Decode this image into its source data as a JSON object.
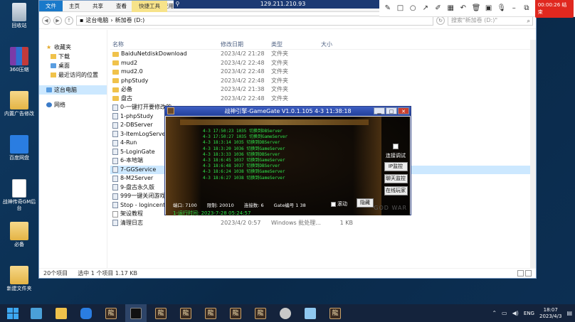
{
  "desktop": {
    "icons": [
      {
        "label": "回收站",
        "icon": "recycle-bin-icon"
      },
      {
        "label": "360压缩",
        "icon": "archive-app-icon"
      },
      {
        "label": "内置广告修改",
        "icon": "folder-icon"
      },
      {
        "label": "百度网盘",
        "icon": "baidu-netdisk-icon"
      },
      {
        "label": "战神传奇GM后台",
        "icon": "file-icon"
      },
      {
        "label": "必备",
        "icon": "folder-icon"
      },
      {
        "label": "新建文件夹",
        "icon": "folder-icon"
      }
    ]
  },
  "remote": {
    "ip": "129.211.210.93",
    "recording": "00:00:26 结束"
  },
  "explorer": {
    "ribbon_tabs": [
      "文件",
      "主页",
      "共享",
      "查看",
      "管理",
      "应用"
    ],
    "context_label": "快捷工具",
    "address": [
      "这台电脑",
      "新加卷 (D:)"
    ],
    "search_placeholder": "搜索\"新加卷 (D:)\"",
    "nav": {
      "quick_access": "收藏夹",
      "downloads": "下载",
      "desktop": "桌面",
      "recent": "最近访问的位置",
      "this_pc": "这台电脑",
      "network": "网络"
    },
    "columns": {
      "name": "名称",
      "date": "修改日期",
      "type": "类型",
      "size": "大小"
    },
    "files": [
      {
        "name": "BaiduNetdiskDownload",
        "date": "2023/4/2 21:28",
        "type": "文件夹",
        "size": "",
        "kind": "folder"
      },
      {
        "name": "mud2",
        "date": "2023/4/2 22:48",
        "type": "文件夹",
        "size": "",
        "kind": "folder"
      },
      {
        "name": "mud2.0",
        "date": "2023/4/2 22:48",
        "type": "文件夹",
        "size": "",
        "kind": "folder"
      },
      {
        "name": "phpStudy",
        "date": "2023/4/2 22:48",
        "type": "文件夹",
        "size": "",
        "kind": "folder"
      },
      {
        "name": "必备",
        "date": "2023/4/2 21:38",
        "type": "文件夹",
        "size": "",
        "kind": "folder"
      },
      {
        "name": "盘古",
        "date": "2023/4/2 22:48",
        "type": "文件夹",
        "size": "",
        "kind": "folder"
      },
      {
        "name": "0-一键打开要修改的",
        "date": "",
        "type": "",
        "size": "",
        "kind": "bat"
      },
      {
        "name": "1-phpStudy",
        "date": "",
        "type": "",
        "size": "",
        "kind": "bat"
      },
      {
        "name": "2-DBServer",
        "date": "",
        "type": "",
        "size": "",
        "kind": "bat"
      },
      {
        "name": "3-ItemLogServer(",
        "date": "",
        "type": "",
        "size": "",
        "kind": "bat"
      },
      {
        "name": "4-Run",
        "date": "",
        "type": "",
        "size": "",
        "kind": "bat"
      },
      {
        "name": "5-LoginGate",
        "date": "",
        "type": "",
        "size": "",
        "kind": "bat"
      },
      {
        "name": "6-本地端",
        "date": "",
        "type": "",
        "size": "",
        "kind": "bat"
      },
      {
        "name": "7-GGService",
        "date": "",
        "type": "",
        "size": "",
        "kind": "bat",
        "selected": true
      },
      {
        "name": "8-M2Server",
        "date": "",
        "type": "",
        "size": "",
        "kind": "bat"
      },
      {
        "name": "9-盘古永久版",
        "date": "",
        "type": "",
        "size": "",
        "kind": "bat"
      },
      {
        "name": "999一键关闭游戏",
        "date": "",
        "type": "",
        "size": "",
        "kind": "bat"
      },
      {
        "name": "Stop - logincenter",
        "date": "",
        "type": "",
        "size": "",
        "kind": "bat"
      },
      {
        "name": "架设教程",
        "date": "2023/4/2 1:29",
        "type": "",
        "size": "",
        "kind": "doc"
      },
      {
        "name": "清理日志",
        "date": "2023/4/2 0:57",
        "type": "Windows 批处理...",
        "size": "1 KB",
        "kind": "bat"
      }
    ],
    "status": {
      "count": "20个项目",
      "selected": "选中 1 个项目 1.17 KB"
    }
  },
  "gate": {
    "title": "战神引擎-GameGate V1.0.1.105 4-3 11:38:18",
    "log": [
      "4-3 17:50:23 1035 切换到DBServer",
      "4-3 17:50:27 1035 切换到GameServer",
      "4-3 18:3:14 1035 切换到DBServer",
      "4-3 18:3:20 1036 切换到GameServer",
      "4-3 18:3:33 1036 切换到DBServer",
      "4-3 18:6:45 1037 切换到GameServer",
      "4-3 18:6:48 1037 切换到DBServer",
      "4-3 18:6:24 1038 切换到GameServer",
      "4-3 18:6:27 1038 切换到GameServer"
    ],
    "port": "端口: 7100",
    "limit": "限制: 20010",
    "connections": "连接数: 6",
    "gate_no": "Gate编号 1 38",
    "scroll_label": "滚动",
    "hide_button": "隐藏",
    "side_check_label": "连接调试",
    "btn_monitor": "IP监控",
    "btn_chat": "聊天监控",
    "btn_online": "在线玩家",
    "runtime": "1-运行时间: 2023-7-28 05:24:57",
    "watermark": "GOD WAR"
  },
  "taskbar": {
    "time": "18:07",
    "date": "2023/4/3",
    "lang": "ENG"
  }
}
